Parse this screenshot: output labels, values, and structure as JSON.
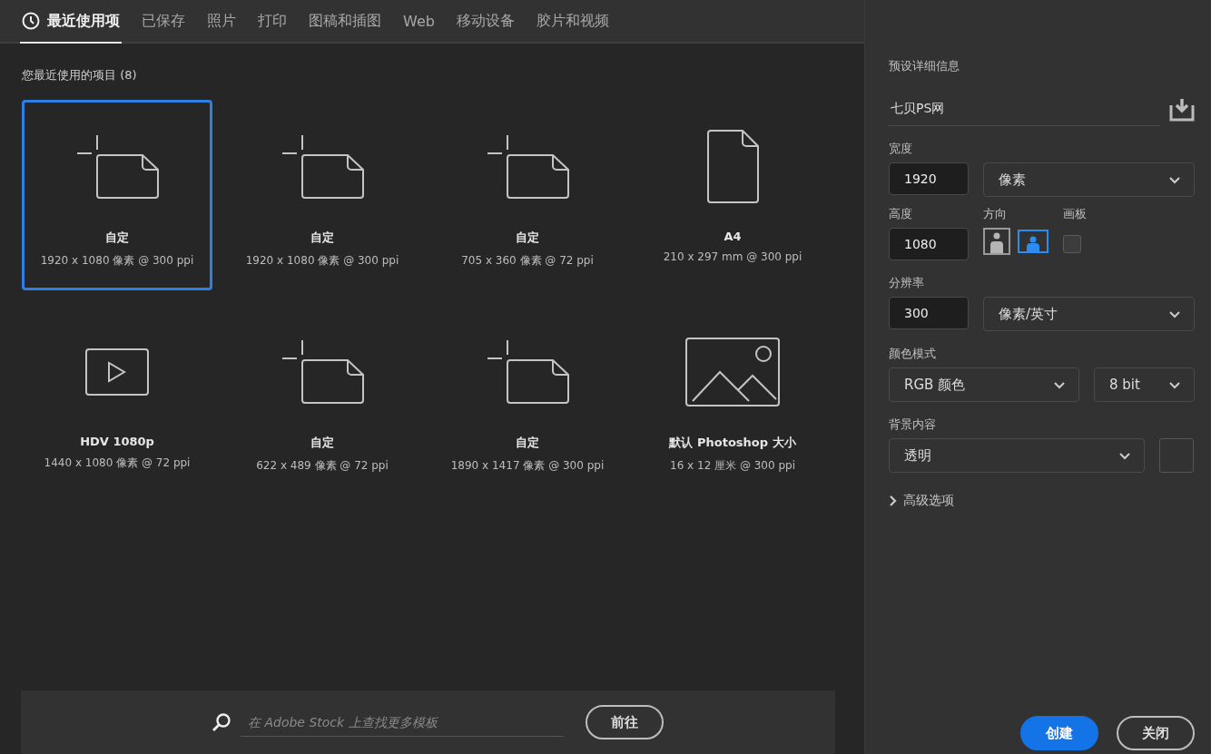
{
  "tabs": [
    {
      "kind": "recent",
      "label": "最近使用项",
      "selected": true
    },
    {
      "kind": "plain",
      "label": "已保存",
      "selected": false
    },
    {
      "kind": "plain",
      "label": "照片",
      "selected": false
    },
    {
      "kind": "plain",
      "label": "打印",
      "selected": false
    },
    {
      "kind": "plain",
      "label": "图稿和插图",
      "selected": false
    },
    {
      "kind": "plain",
      "label": "Web",
      "selected": false
    },
    {
      "kind": "plain",
      "label": "移动设备",
      "selected": false
    },
    {
      "kind": "plain",
      "label": "胶片和视频",
      "selected": false
    }
  ],
  "recent": {
    "title": "您最近使用的项目 (8)",
    "presets": [
      {
        "kind": "custom",
        "name": "自定",
        "size": "1920 x 1080 像素 @ 300 ppi",
        "selected": true
      },
      {
        "kind": "custom",
        "name": "自定",
        "size": "1920 x 1080 像素 @ 300 ppi",
        "selected": false
      },
      {
        "kind": "custom",
        "name": "自定",
        "size": "705 x 360 像素 @ 72 ppi",
        "selected": false
      },
      {
        "kind": "document",
        "name": "A4",
        "size": "210 x 297 mm @ 300 ppi",
        "selected": false
      },
      {
        "kind": "video",
        "name": "HDV 1080p",
        "size": "1440 x 1080 像素 @ 72 ppi",
        "selected": false
      },
      {
        "kind": "custom",
        "name": "自定",
        "size": "622 x 489 像素 @ 72 ppi",
        "selected": false
      },
      {
        "kind": "custom",
        "name": "自定",
        "size": "1890 x 1417 像素 @ 300 ppi",
        "selected": false
      },
      {
        "kind": "photo",
        "name": "默认 Photoshop 大小",
        "size": "16 x 12 厘米 @ 300 ppi",
        "selected": false
      }
    ]
  },
  "stock_search": {
    "placeholder": "在 Adobe Stock 上查找更多模板",
    "button": "前往"
  },
  "details": {
    "title": "预设详细信息",
    "name": "七贝PS网",
    "width": {
      "label": "宽度",
      "value": "1920",
      "unit": "像素"
    },
    "height": {
      "label": "高度",
      "value": "1080"
    },
    "orientation": {
      "label": "方向",
      "options": [
        {
          "kind": "portrait",
          "selected": false
        },
        {
          "kind": "landscape",
          "selected": true
        }
      ]
    },
    "artboard": {
      "label": "画板",
      "checked": false
    },
    "resolution": {
      "label": "分辨率",
      "value": "300",
      "unit": "像素/英寸"
    },
    "color_mode": {
      "label": "颜色模式",
      "mode": "RGB 颜色",
      "depth": "8 bit"
    },
    "background": {
      "label": "背景内容",
      "value": "透明"
    },
    "advanced": {
      "label": "高级选项",
      "expanded": false
    }
  },
  "buttons": {
    "create": "创建",
    "close": "关闭"
  }
}
